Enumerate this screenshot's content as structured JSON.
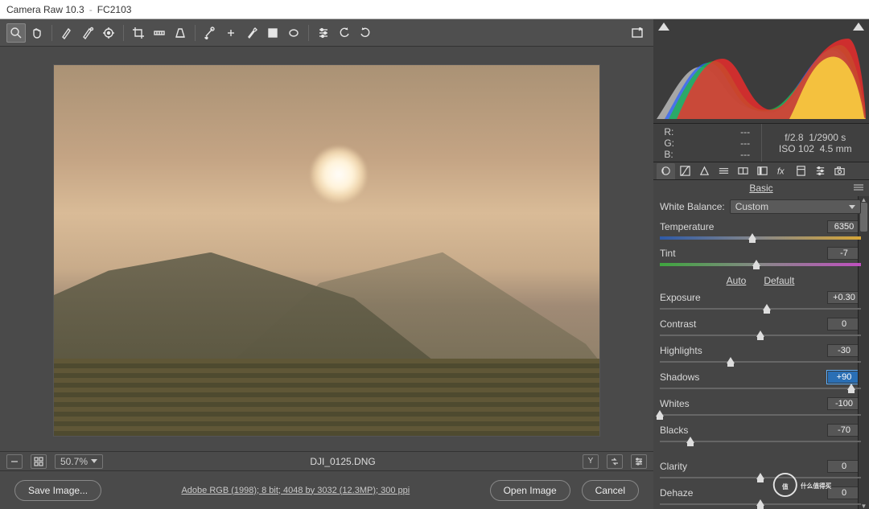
{
  "title": {
    "app": "Camera Raw 10.3",
    "doc": "FC2103"
  },
  "toolbar": {
    "tools": [
      "zoom",
      "hand",
      "white-balance",
      "color-sampler",
      "target-adjust",
      "crop",
      "straighten",
      "transform",
      "spot-removal",
      "red-eye",
      "brush",
      "graduated-filter",
      "radial-filter",
      "preferences",
      "rotate-ccw",
      "rotate-cw"
    ],
    "fullscreen": "fullscreen"
  },
  "image": {
    "filename": "DJI_0125.DNG",
    "zoom": "50.7%"
  },
  "infobar": {
    "toggle1": "grid",
    "toggle2": "plus",
    "right_icons": [
      "y-toggle",
      "compare",
      "sliders"
    ]
  },
  "meta": {
    "line": "Adobe RGB (1998); 8 bit; 4048 by 3032 (12.3MP); 300 ppi"
  },
  "buttons": {
    "save": "Save Image...",
    "open": "Open Image",
    "cancel": "Cancel"
  },
  "exif": {
    "rgb": {
      "R": "---",
      "G": "---",
      "B": "---"
    },
    "camera": {
      "aperture": "f/2.8",
      "shutter": "1/2900 s",
      "iso": "ISO 102",
      "focal": "4.5 mm"
    }
  },
  "panel": {
    "tabs": [
      "basic",
      "curve",
      "detail",
      "hsl",
      "split",
      "lens",
      "fx",
      "calibration",
      "presets",
      "snapshots"
    ],
    "title": "Basic",
    "wb_label": "White Balance:",
    "wb_value": "Custom",
    "temperature": {
      "label": "Temperature",
      "value": "6350",
      "pos": 46
    },
    "tint": {
      "label": "Tint",
      "value": "-7",
      "pos": 48
    },
    "auto_label": "Auto",
    "default_label": "Default",
    "exposure": {
      "label": "Exposure",
      "value": "+0.30",
      "pos": 53
    },
    "contrast": {
      "label": "Contrast",
      "value": "0",
      "pos": 50
    },
    "highlights": {
      "label": "Highlights",
      "value": "-30",
      "pos": 35
    },
    "shadows": {
      "label": "Shadows",
      "value": "+90",
      "pos": 95,
      "focused": true
    },
    "whites": {
      "label": "Whites",
      "value": "-100",
      "pos": 0
    },
    "blacks": {
      "label": "Blacks",
      "value": "-70",
      "pos": 15
    },
    "clarity": {
      "label": "Clarity",
      "value": "0",
      "pos": 50
    },
    "dehaze": {
      "label": "Dehaze",
      "value": "0",
      "pos": 50
    }
  },
  "watermark": "值 什么值得买"
}
